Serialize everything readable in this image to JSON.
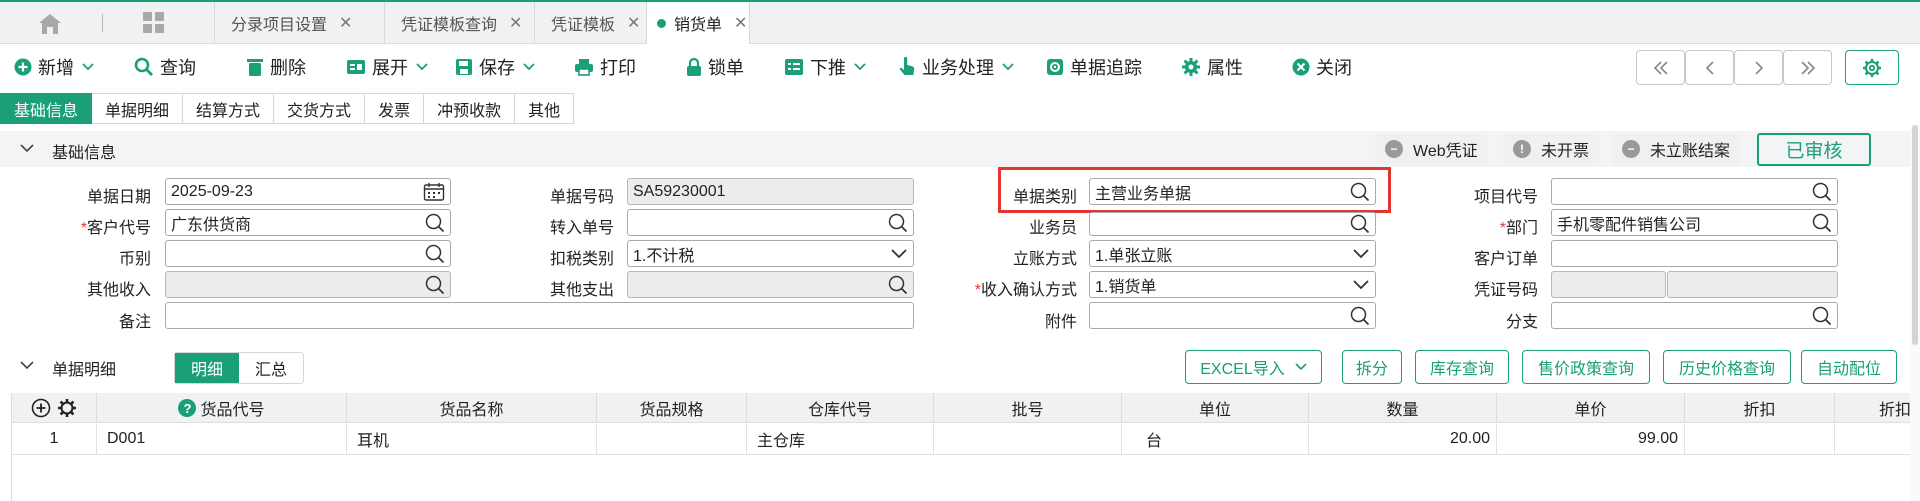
{
  "tabs": [
    {
      "label": "分录项目设置"
    },
    {
      "label": "凭证模板查询"
    },
    {
      "label": "凭证模板"
    },
    {
      "label": "销货单"
    }
  ],
  "toolbar": {
    "add": "新增",
    "query": "查询",
    "delete": "删除",
    "expand": "展开",
    "save": "保存",
    "print": "打印",
    "lock": "锁单",
    "push": "下推",
    "business": "业务处理",
    "trace": "单据追踪",
    "props": "属性",
    "close": "关闭"
  },
  "subtabs": [
    "基础信息",
    "单据明细",
    "结算方式",
    "交货方式",
    "发票",
    "冲预收款",
    "其他"
  ],
  "basic_section": {
    "title": "基础信息",
    "badges": [
      "Web凭证",
      "未开票",
      "未立账结案"
    ],
    "status": "已审核"
  },
  "form": {
    "doc_date": {
      "label": "单据日期",
      "value": "2025-09-23"
    },
    "doc_no": {
      "label": "单据号码",
      "value": "SA59230001"
    },
    "doc_type": {
      "label": "单据类别",
      "value": "主营业务单据"
    },
    "project_code": {
      "label": "项目代号",
      "value": ""
    },
    "customer_code": {
      "label": "客户代号",
      "value": "广东供货商"
    },
    "transfer_no": {
      "label": "转入单号",
      "value": ""
    },
    "salesman": {
      "label": "业务员",
      "value": ""
    },
    "department": {
      "label": "部门",
      "value": "手机零配件销售公司"
    },
    "currency": {
      "label": "币别",
      "value": ""
    },
    "tax_type": {
      "label": "扣税类别",
      "value": "1.不计税"
    },
    "account_method": {
      "label": "立账方式",
      "value": "1.单张立账"
    },
    "customer_order": {
      "label": "客户订单",
      "value": ""
    },
    "other_income": {
      "label": "其他收入",
      "value": ""
    },
    "other_expense": {
      "label": "其他支出",
      "value": ""
    },
    "revenue_confirm": {
      "label": "收入确认方式",
      "value": "1.销货单"
    },
    "voucher_no": {
      "label": "凭证号码",
      "value": ""
    },
    "remark": {
      "label": "备注",
      "value": ""
    },
    "attachment": {
      "label": "附件",
      "value": ""
    },
    "branch": {
      "label": "分支",
      "value": ""
    }
  },
  "detail_section": {
    "title": "单据明细",
    "seg": [
      "明细",
      "汇总"
    ],
    "buttons": [
      "EXCEL导入",
      "拆分",
      "库存查询",
      "售价政策查询",
      "历史价格查询",
      "自动配位"
    ]
  },
  "grid": {
    "columns": [
      "货品代号",
      "货品名称",
      "货品规格",
      "仓库代号",
      "批号",
      "单位",
      "数量",
      "单价",
      "折扣",
      "折扣"
    ],
    "rows": [
      {
        "no": "1",
        "code": "D001",
        "name": "耳机",
        "spec": "",
        "warehouse": "主仓库",
        "batch": "",
        "unit": "台",
        "qty": "20.00",
        "price": "99.00",
        "disc": "",
        "disc2": ""
      }
    ]
  },
  "colors": {
    "accent": "#1a9f78",
    "highlight": "#e5352f",
    "required": "#e23c3c"
  }
}
